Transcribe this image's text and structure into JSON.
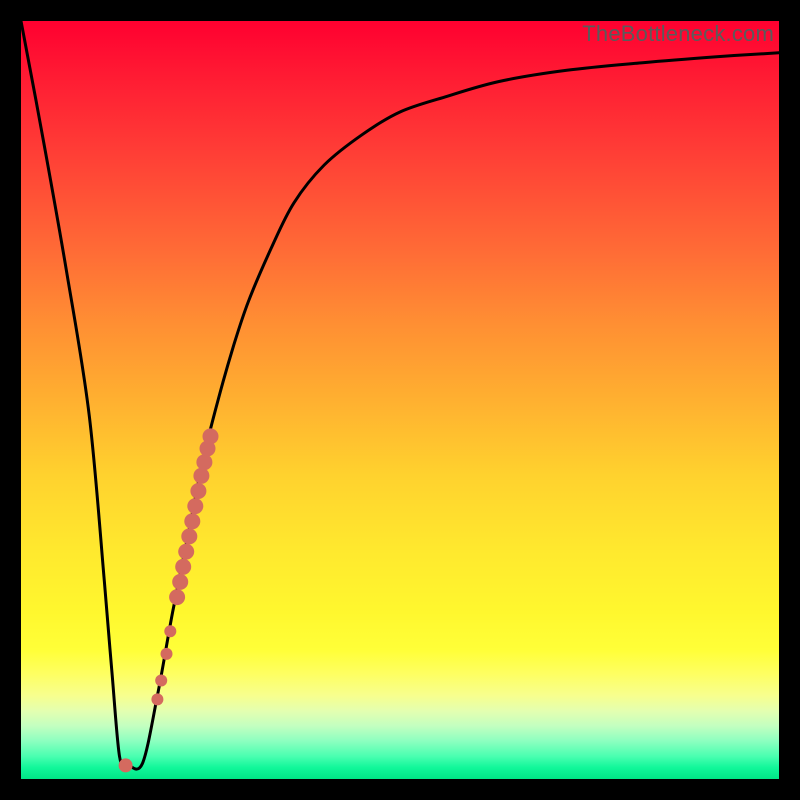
{
  "watermark": "TheBottleneck.com",
  "colors": {
    "curve": "#000000",
    "marker": "#d46a5f",
    "frame": "#000000"
  },
  "chart_data": {
    "type": "line",
    "title": "",
    "xlabel": "",
    "ylabel": "",
    "xlim": [
      0,
      100
    ],
    "ylim": [
      0,
      100
    ],
    "grid": false,
    "series": [
      {
        "name": "bottleneck-curve",
        "x": [
          0,
          3,
          6,
          9,
          11,
          12,
          13,
          14,
          16,
          18,
          20,
          22,
          24,
          26,
          28,
          30,
          33,
          36,
          40,
          45,
          50,
          56,
          63,
          72,
          82,
          92,
          100
        ],
        "y": [
          100,
          84,
          67,
          48,
          26,
          14,
          3,
          2,
          2,
          11,
          22,
          32,
          42,
          50,
          57,
          63,
          70,
          76,
          81,
          85,
          88,
          90,
          92,
          93.5,
          94.5,
          95.3,
          95.8
        ]
      }
    ],
    "markers": [
      {
        "x": 18.0,
        "y": 10.5,
        "r": 6
      },
      {
        "x": 18.5,
        "y": 13.0,
        "r": 6
      },
      {
        "x": 19.2,
        "y": 16.5,
        "r": 6
      },
      {
        "x": 19.7,
        "y": 19.5,
        "r": 6
      },
      {
        "x": 20.6,
        "y": 24.0,
        "r": 8
      },
      {
        "x": 21.0,
        "y": 26.0,
        "r": 8
      },
      {
        "x": 21.4,
        "y": 28.0,
        "r": 8
      },
      {
        "x": 21.8,
        "y": 30.0,
        "r": 8
      },
      {
        "x": 22.2,
        "y": 32.0,
        "r": 8
      },
      {
        "x": 22.6,
        "y": 34.0,
        "r": 8
      },
      {
        "x": 23.0,
        "y": 36.0,
        "r": 8
      },
      {
        "x": 23.4,
        "y": 38.0,
        "r": 8
      },
      {
        "x": 23.8,
        "y": 40.0,
        "r": 8
      },
      {
        "x": 24.2,
        "y": 41.8,
        "r": 8
      },
      {
        "x": 24.6,
        "y": 43.6,
        "r": 8
      },
      {
        "x": 25.0,
        "y": 45.2,
        "r": 8
      },
      {
        "x": 13.8,
        "y": 1.8,
        "r": 7
      }
    ]
  }
}
